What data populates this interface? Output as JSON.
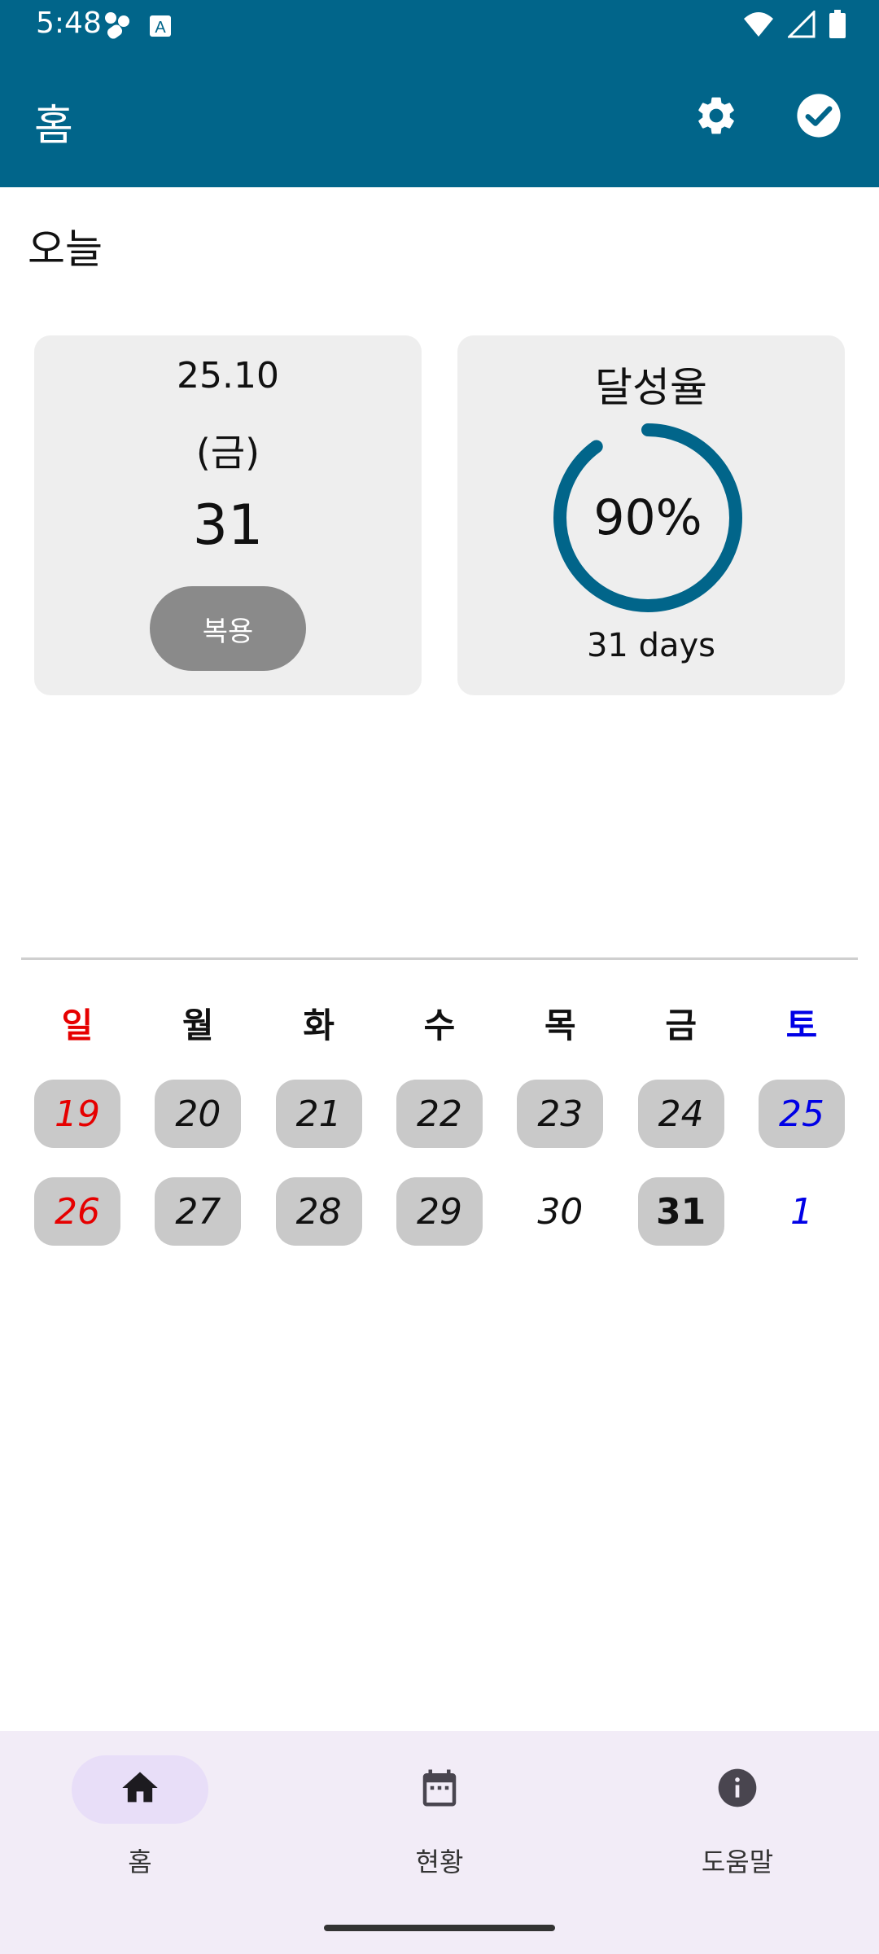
{
  "status_bar": {
    "time": "5:48",
    "icons": [
      "app-notification-icon",
      "accessibility-a-icon",
      "wifi-icon",
      "signal-icon",
      "battery-icon"
    ]
  },
  "app_bar": {
    "title": "홈",
    "actions": [
      "settings-icon",
      "check-circle-icon"
    ],
    "color": "#01658a"
  },
  "today": {
    "section_title": "오늘",
    "date_year_month": "25.10",
    "weekday": "(금)",
    "day": "31",
    "take_button": "복용"
  },
  "achievement": {
    "title": "달성율",
    "percent_label": "90%",
    "percent": 0.9,
    "days_label": "31 days",
    "ring_color": "#01658a"
  },
  "calendar": {
    "weekdays": [
      "일",
      "월",
      "화",
      "수",
      "목",
      "금",
      "토"
    ],
    "week1": [
      {
        "d": "19",
        "type": "sun",
        "filled": true
      },
      {
        "d": "20",
        "type": "",
        "filled": true
      },
      {
        "d": "21",
        "type": "",
        "filled": true
      },
      {
        "d": "22",
        "type": "",
        "filled": true
      },
      {
        "d": "23",
        "type": "",
        "filled": true
      },
      {
        "d": "24",
        "type": "",
        "filled": true
      },
      {
        "d": "25",
        "type": "sat",
        "filled": true
      }
    ],
    "week2": [
      {
        "d": "26",
        "type": "sun",
        "filled": true
      },
      {
        "d": "27",
        "type": "",
        "filled": true
      },
      {
        "d": "28",
        "type": "",
        "filled": true
      },
      {
        "d": "29",
        "type": "",
        "filled": true
      },
      {
        "d": "30",
        "type": "",
        "filled": false
      },
      {
        "d": "31",
        "type": "today",
        "filled": true
      },
      {
        "d": "1",
        "type": "sat",
        "filled": false
      }
    ],
    "sunday_color": "#e60000",
    "saturday_color": "#0000e6"
  },
  "bottom_nav": {
    "items": [
      {
        "label": "홈",
        "icon": "home-icon",
        "active": true
      },
      {
        "label": "현황",
        "icon": "calendar-icon",
        "active": false
      },
      {
        "label": "도움말",
        "icon": "info-icon",
        "active": false
      }
    ]
  }
}
